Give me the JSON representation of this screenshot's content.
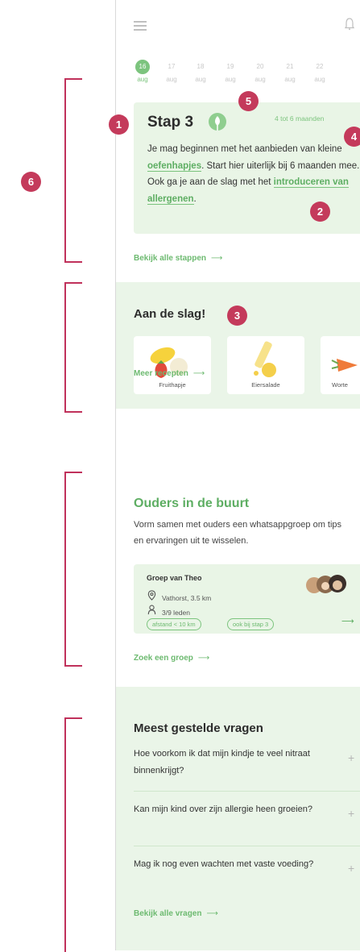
{
  "header": {
    "menu_icon": "hamburger-menu-icon",
    "bell_icon": "bell-icon"
  },
  "dates": [
    {
      "num": "16",
      "mon": "aug",
      "active": true
    },
    {
      "num": "17",
      "mon": "aug"
    },
    {
      "num": "18",
      "mon": "aug"
    },
    {
      "num": "19",
      "mon": "aug"
    },
    {
      "num": "20",
      "mon": "aug"
    },
    {
      "num": "21",
      "mon": "aug"
    },
    {
      "num": "22",
      "mon": "aug"
    }
  ],
  "stap": {
    "title": "Stap 3",
    "range": "4 tot 6 maanden",
    "text_1": "Je mag beginnen met het aanbieden van kleine ",
    "link_1": "oefenhapjes",
    "text_2": ". Start hier uiterlijk bij 6 maanden mee. Ook ga je aan de slag met het ",
    "link_2": "introduceren van allergenen",
    "text_3": ".",
    "all_link": "Bekijk alle stappen"
  },
  "recipes": {
    "title": "Aan de slag!",
    "items": [
      "Fruithapje",
      "Eiersalade",
      "Worte"
    ],
    "more_link": "Meer recepten"
  },
  "ouders": {
    "title": "Ouders in de buurt",
    "text": "Vorm samen met ouders een whatsappgroep om tips en ervaringen uit te wisselen.",
    "group_title": "Groep van Theo",
    "location": "Vathorst, 3.5 km",
    "members": "3/9 leden",
    "chip_1": "afstand < 10 km",
    "chip_2": "ook bij stap 3",
    "search_link": "Zoek een groep"
  },
  "faq": {
    "title": "Meest gestelde vragen",
    "questions": [
      "Hoe voorkom ik dat mijn kindje te veel nitraat binnenkrijgt?",
      "Kan mijn kind over zijn allergie heen groeien?",
      "Mag ik nog even wachten met vaste voeding?"
    ],
    "all_link": "Bekijk alle vragen"
  },
  "annotations": [
    "1",
    "2",
    "3",
    "4",
    "5",
    "6"
  ],
  "colors": {
    "accent": "#7cc47e",
    "annotation": "#c43a5b",
    "section_bg": "#eaf5e8"
  }
}
